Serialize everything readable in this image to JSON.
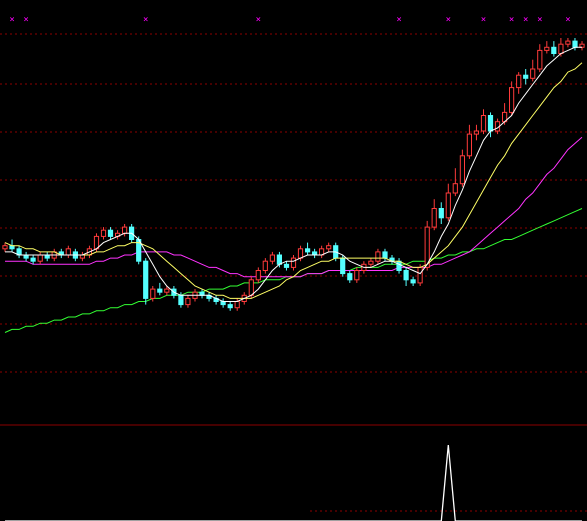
{
  "colors": {
    "background": "#000000",
    "grid": "#8b0000",
    "up_candle": "#ff3b3b",
    "down_candle": "#54ffff",
    "ma5": "#ffffff",
    "ma10": "#ffff66",
    "ma20": "#ff33ff",
    "ma60": "#33ff33",
    "signal": "#ffffff",
    "marker": "#ff00ff"
  },
  "chart_data": [
    {
      "type": "candlestick",
      "panel": "main",
      "ylim": [
        0,
        100
      ],
      "x": [
        0,
        1,
        2,
        3,
        4,
        5,
        6,
        7,
        8,
        9,
        10,
        11,
        12,
        13,
        14,
        15,
        16,
        17,
        18,
        19,
        20,
        21,
        22,
        23,
        24,
        25,
        26,
        27,
        28,
        29,
        30,
        31,
        32,
        33,
        34,
        35,
        36,
        37,
        38,
        39,
        40,
        41,
        42,
        43,
        44,
        45,
        46,
        47,
        48,
        49,
        50,
        51,
        52,
        53,
        54,
        55,
        56,
        57,
        58,
        59,
        60,
        61,
        62,
        63,
        64,
        65,
        66,
        67,
        68,
        69,
        70,
        71,
        72,
        73,
        74,
        75,
        76,
        77,
        78,
        79,
        80,
        81,
        82
      ],
      "candles": [
        [
          32,
          33,
          34,
          31
        ],
        [
          33,
          32,
          35,
          31
        ],
        [
          32,
          30,
          33,
          29
        ],
        [
          30,
          29,
          31,
          28
        ],
        [
          29,
          28,
          30,
          27
        ],
        [
          28,
          30,
          31,
          27
        ],
        [
          30,
          29,
          31,
          28
        ],
        [
          29,
          31,
          32,
          28
        ],
        [
          31,
          30,
          32,
          29
        ],
        [
          30,
          32,
          33,
          29
        ],
        [
          31,
          29,
          32,
          28
        ],
        [
          29,
          30,
          31,
          28
        ],
        [
          30,
          32,
          33,
          29
        ],
        [
          32,
          36,
          37,
          31
        ],
        [
          36,
          38,
          39,
          35
        ],
        [
          38,
          36,
          39,
          35
        ],
        [
          36,
          37,
          38,
          35
        ],
        [
          37,
          39,
          40,
          36
        ],
        [
          39,
          35,
          40,
          34
        ],
        [
          35,
          28,
          36,
          27
        ],
        [
          28,
          16,
          29,
          14
        ],
        [
          16,
          19,
          20,
          15
        ],
        [
          19,
          18,
          21,
          17
        ],
        [
          18,
          19,
          20,
          17
        ],
        [
          19,
          17,
          20,
          16
        ],
        [
          17,
          14,
          18,
          13
        ],
        [
          14,
          16,
          17,
          13
        ],
        [
          16,
          18,
          19,
          15
        ],
        [
          18,
          17,
          19,
          16
        ],
        [
          17,
          16,
          18,
          15
        ],
        [
          16,
          15,
          17,
          14
        ],
        [
          15,
          14,
          16,
          13
        ],
        [
          14,
          13,
          15,
          12
        ],
        [
          13,
          15,
          16,
          12
        ],
        [
          15,
          17,
          18,
          14
        ],
        [
          17,
          22,
          23,
          16
        ],
        [
          22,
          25,
          26,
          21
        ],
        [
          25,
          28,
          29,
          24
        ],
        [
          28,
          30,
          31,
          27
        ],
        [
          30,
          27,
          31,
          26
        ],
        [
          27,
          26,
          28,
          25
        ],
        [
          26,
          29,
          30,
          25
        ],
        [
          29,
          32,
          33,
          28
        ],
        [
          32,
          31,
          34,
          30
        ],
        [
          31,
          30,
          32,
          29
        ],
        [
          30,
          32,
          33,
          29
        ],
        [
          32,
          33,
          34,
          31
        ],
        [
          33,
          29,
          34,
          28
        ],
        [
          29,
          24,
          30,
          23
        ],
        [
          24,
          22,
          25,
          21
        ],
        [
          22,
          25,
          26,
          21
        ],
        [
          25,
          27,
          28,
          24
        ],
        [
          27,
          28,
          29,
          26
        ],
        [
          28,
          31,
          32,
          27
        ],
        [
          31,
          29,
          32,
          28
        ],
        [
          29,
          28,
          30,
          27
        ],
        [
          28,
          25,
          29,
          24
        ],
        [
          25,
          22,
          26,
          20
        ],
        [
          22,
          21,
          23,
          20
        ],
        [
          21,
          26,
          27,
          20
        ],
        [
          26,
          39,
          41,
          25
        ],
        [
          39,
          45,
          48,
          38
        ],
        [
          45,
          42,
          47,
          40
        ],
        [
          42,
          50,
          53,
          41
        ],
        [
          50,
          53,
          58,
          49
        ],
        [
          53,
          62,
          64,
          52
        ],
        [
          62,
          69,
          72,
          61
        ],
        [
          69,
          70,
          72,
          67
        ],
        [
          70,
          75,
          77,
          69
        ],
        [
          75,
          70,
          76,
          68
        ],
        [
          70,
          73,
          74,
          69
        ],
        [
          73,
          76,
          79,
          72
        ],
        [
          76,
          84,
          86,
          75
        ],
        [
          84,
          88,
          89,
          82
        ],
        [
          88,
          87,
          90,
          85
        ],
        [
          87,
          90,
          93,
          86
        ],
        [
          90,
          96,
          98,
          89
        ],
        [
          96,
          97,
          99,
          95
        ],
        [
          97,
          95,
          99,
          94
        ],
        [
          95,
          98,
          100,
          94
        ],
        [
          98,
          99,
          100,
          97
        ],
        [
          99,
          97,
          100,
          96
        ],
        [
          97,
          98,
          99,
          96
        ]
      ],
      "ma5": [
        31,
        31,
        30,
        30,
        30,
        30,
        30,
        30,
        30,
        30,
        30,
        30,
        31,
        32,
        34,
        35,
        36,
        37,
        37,
        35,
        31,
        27,
        23,
        20,
        18,
        17,
        17,
        17,
        17,
        17,
        16,
        15,
        15,
        15,
        16,
        17,
        19,
        22,
        25,
        27,
        28,
        28,
        29,
        30,
        30,
        30,
        31,
        31,
        30,
        28,
        27,
        26,
        26,
        27,
        28,
        28,
        27,
        26,
        25,
        24,
        27,
        31,
        36,
        40,
        46,
        51,
        57,
        62,
        67,
        70,
        71,
        73,
        75,
        79,
        82,
        85,
        88,
        91,
        93,
        95,
        96,
        97,
        97
      ],
      "ma10": [
        34,
        33,
        33,
        32,
        32,
        31,
        31,
        31,
        30,
        30,
        30,
        30,
        30,
        31,
        31,
        32,
        33,
        33,
        34,
        34,
        33,
        32,
        30,
        28,
        26,
        24,
        22,
        20,
        19,
        18,
        17,
        17,
        16,
        16,
        16,
        16,
        17,
        18,
        19,
        20,
        22,
        23,
        25,
        26,
        27,
        28,
        28,
        29,
        29,
        29,
        29,
        29,
        29,
        29,
        29,
        28,
        28,
        27,
        26,
        26,
        27,
        29,
        31,
        33,
        36,
        39,
        43,
        47,
        51,
        55,
        59,
        62,
        66,
        69,
        72,
        75,
        78,
        81,
        84,
        86,
        89,
        90,
        92
      ],
      "ma20": [
        28,
        28,
        28,
        28,
        27,
        27,
        27,
        27,
        27,
        27,
        27,
        27,
        27,
        28,
        28,
        29,
        29,
        30,
        30,
        31,
        31,
        31,
        31,
        31,
        30,
        30,
        29,
        28,
        27,
        26,
        26,
        25,
        24,
        24,
        23,
        23,
        23,
        23,
        23,
        23,
        23,
        23,
        23,
        24,
        24,
        24,
        25,
        25,
        25,
        25,
        25,
        25,
        25,
        25,
        25,
        25,
        26,
        26,
        26,
        26,
        26,
        27,
        27,
        28,
        29,
        30,
        31,
        33,
        35,
        37,
        39,
        41,
        43,
        45,
        48,
        50,
        53,
        56,
        58,
        61,
        64,
        66,
        68
      ],
      "ma60": [
        5,
        6,
        6,
        7,
        7,
        8,
        8,
        9,
        9,
        10,
        10,
        11,
        11,
        12,
        12,
        13,
        13,
        14,
        14,
        15,
        15,
        16,
        16,
        17,
        17,
        17,
        18,
        18,
        18,
        19,
        19,
        19,
        20,
        20,
        21,
        21,
        21,
        22,
        22,
        22,
        23,
        23,
        23,
        24,
        24,
        24,
        25,
        25,
        25,
        25,
        26,
        26,
        26,
        26,
        27,
        27,
        27,
        27,
        28,
        28,
        28,
        29,
        29,
        30,
        30,
        31,
        31,
        32,
        32,
        33,
        34,
        35,
        35,
        36,
        37,
        38,
        39,
        40,
        41,
        42,
        43,
        44,
        45
      ],
      "markers": [
        1,
        3,
        20,
        36,
        56,
        63,
        68,
        72,
        74,
        76,
        80
      ]
    },
    {
      "type": "line",
      "panel": "indicator",
      "ylim": [
        0,
        1
      ],
      "x": [
        0,
        1,
        2,
        3,
        4,
        5,
        6,
        7,
        8,
        9,
        10,
        11,
        12,
        13,
        14,
        15,
        16,
        17,
        18,
        19,
        20,
        21,
        22,
        23,
        24,
        25,
        26,
        27,
        28,
        29,
        30,
        31,
        32,
        33,
        34,
        35,
        36,
        37,
        38,
        39,
        40,
        41,
        42,
        43,
        44,
        45,
        46,
        47,
        48,
        49,
        50,
        51,
        52,
        53,
        54,
        55,
        56,
        57,
        58,
        59,
        60,
        61,
        62,
        63,
        64,
        65,
        66,
        67,
        68,
        69,
        70,
        71,
        72,
        73,
        74,
        75,
        76,
        77,
        78,
        79,
        80,
        81,
        82
      ],
      "series": [
        {
          "values": [
            0,
            0,
            0,
            0,
            0,
            0,
            0,
            0,
            0,
            0,
            0,
            0,
            0,
            0,
            0,
            0,
            0,
            0,
            0,
            0,
            0,
            0,
            0,
            0,
            0,
            0,
            0,
            0,
            0,
            0,
            0,
            0,
            0,
            0,
            0,
            0,
            0,
            0,
            0,
            0,
            0,
            0,
            0,
            0,
            0,
            0,
            0,
            0,
            0,
            0,
            0,
            0,
            0,
            0,
            0,
            0,
            0,
            0,
            0,
            0,
            0,
            0,
            0,
            1,
            0,
            0,
            0,
            0,
            0,
            0,
            0,
            0,
            0,
            0,
            0,
            0,
            0,
            0,
            0,
            0,
            0,
            0,
            0
          ]
        }
      ]
    }
  ]
}
